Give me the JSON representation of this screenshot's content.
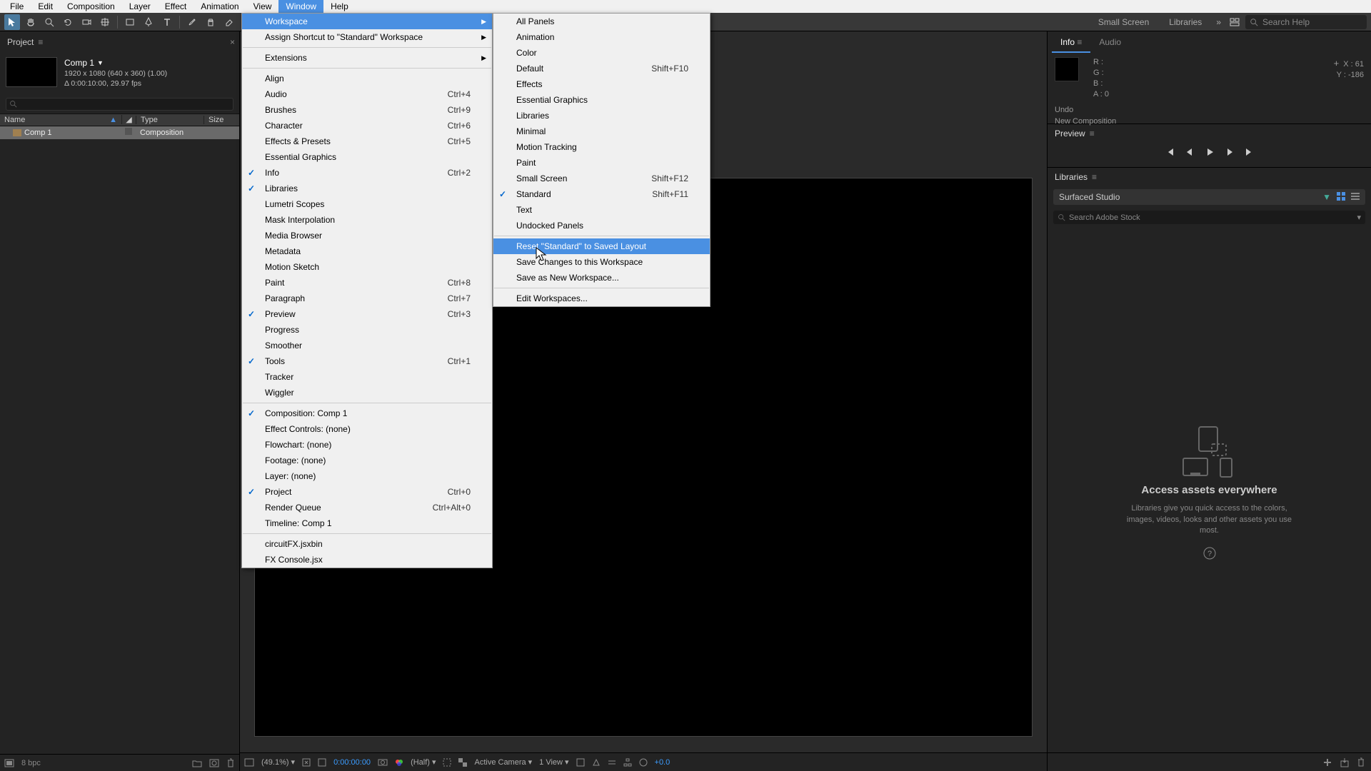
{
  "menubar": [
    "File",
    "Edit",
    "Composition",
    "Layer",
    "Effect",
    "Animation",
    "View",
    "Window",
    "Help"
  ],
  "menubar_active": "Window",
  "toolbar_tabs": {
    "small_screen": "Small Screen",
    "libraries": "Libraries"
  },
  "search_help": "Search Help",
  "project": {
    "tab": "Project",
    "comp_name": "Comp 1",
    "comp_res": "1920 x 1080   (640 x 360) (1.00)",
    "comp_dur": "Δ 0:00:10:00, 29.97 fps",
    "headers": {
      "name": "Name",
      "type": "Type",
      "size": "Size"
    },
    "rows": [
      {
        "name": "Comp 1",
        "type": "Composition",
        "size": ""
      }
    ],
    "footer_bpc": "8 bpc"
  },
  "info": {
    "tab": "Info",
    "audio": "Audio",
    "R": "R :",
    "G": "G :",
    "B": "B :",
    "A": "A : 0",
    "X": "X : 61",
    "Y": "Y : -186",
    "undo": "Undo",
    "newcomp": "New Composition"
  },
  "preview": {
    "tab": "Preview"
  },
  "libraries": {
    "tab": "Libraries",
    "dropdown": "Surfaced Studio",
    "search": "Search Adobe Stock",
    "ph_title": "Access assets everywhere",
    "ph_text": "Libraries give you quick access to the colors, images, videos, looks and other assets you use most."
  },
  "viewer_footer": {
    "zoom": "(49.1%)",
    "timecode": "0:00:00:00",
    "half": "(Half)",
    "active_camera": "Active Camera",
    "one_view": "1 View",
    "plus0": "+0.0"
  },
  "window_menu": [
    {
      "t": "item",
      "label": "Workspace",
      "arrow": true,
      "highlight": true
    },
    {
      "t": "item",
      "label": "Assign Shortcut to \"Standard\" Workspace",
      "arrow": true
    },
    {
      "t": "sep"
    },
    {
      "t": "item",
      "label": "Extensions",
      "arrow": true
    },
    {
      "t": "sep"
    },
    {
      "t": "item",
      "label": "Align"
    },
    {
      "t": "item",
      "label": "Audio",
      "shortcut": "Ctrl+4"
    },
    {
      "t": "item",
      "label": "Brushes",
      "shortcut": "Ctrl+9"
    },
    {
      "t": "item",
      "label": "Character",
      "shortcut": "Ctrl+6"
    },
    {
      "t": "item",
      "label": "Effects & Presets",
      "shortcut": "Ctrl+5"
    },
    {
      "t": "item",
      "label": "Essential Graphics"
    },
    {
      "t": "item",
      "label": "Info",
      "shortcut": "Ctrl+2",
      "check": true
    },
    {
      "t": "item",
      "label": "Libraries",
      "check": true
    },
    {
      "t": "item",
      "label": "Lumetri Scopes"
    },
    {
      "t": "item",
      "label": "Mask Interpolation"
    },
    {
      "t": "item",
      "label": "Media Browser"
    },
    {
      "t": "item",
      "label": "Metadata"
    },
    {
      "t": "item",
      "label": "Motion Sketch"
    },
    {
      "t": "item",
      "label": "Paint",
      "shortcut": "Ctrl+8"
    },
    {
      "t": "item",
      "label": "Paragraph",
      "shortcut": "Ctrl+7"
    },
    {
      "t": "item",
      "label": "Preview",
      "shortcut": "Ctrl+3",
      "check": true
    },
    {
      "t": "item",
      "label": "Progress"
    },
    {
      "t": "item",
      "label": "Smoother"
    },
    {
      "t": "item",
      "label": "Tools",
      "shortcut": "Ctrl+1",
      "check": true
    },
    {
      "t": "item",
      "label": "Tracker"
    },
    {
      "t": "item",
      "label": "Wiggler"
    },
    {
      "t": "sep"
    },
    {
      "t": "item",
      "label": "Composition: Comp 1",
      "check": true
    },
    {
      "t": "item",
      "label": "Effect Controls: (none)"
    },
    {
      "t": "item",
      "label": "Flowchart: (none)"
    },
    {
      "t": "item",
      "label": "Footage: (none)"
    },
    {
      "t": "item",
      "label": "Layer: (none)"
    },
    {
      "t": "item",
      "label": "Project",
      "shortcut": "Ctrl+0",
      "check": true
    },
    {
      "t": "item",
      "label": "Render Queue",
      "shortcut": "Ctrl+Alt+0"
    },
    {
      "t": "item",
      "label": "Timeline: Comp 1"
    },
    {
      "t": "sep"
    },
    {
      "t": "item",
      "label": "circuitFX.jsxbin"
    },
    {
      "t": "item",
      "label": "FX Console.jsx"
    }
  ],
  "workspace_submenu": [
    {
      "t": "item",
      "label": "All Panels"
    },
    {
      "t": "item",
      "label": "Animation"
    },
    {
      "t": "item",
      "label": "Color"
    },
    {
      "t": "item",
      "label": "Default",
      "shortcut": "Shift+F10"
    },
    {
      "t": "item",
      "label": "Effects"
    },
    {
      "t": "item",
      "label": "Essential Graphics"
    },
    {
      "t": "item",
      "label": "Libraries"
    },
    {
      "t": "item",
      "label": "Minimal"
    },
    {
      "t": "item",
      "label": "Motion Tracking"
    },
    {
      "t": "item",
      "label": "Paint"
    },
    {
      "t": "item",
      "label": "Small Screen",
      "shortcut": "Shift+F12"
    },
    {
      "t": "item",
      "label": "Standard",
      "shortcut": "Shift+F11",
      "check": true
    },
    {
      "t": "item",
      "label": "Text"
    },
    {
      "t": "item",
      "label": "Undocked Panels"
    },
    {
      "t": "sep"
    },
    {
      "t": "item",
      "label": "Reset \"Standard\" to Saved Layout",
      "highlight": true
    },
    {
      "t": "item",
      "label": "Save Changes to this Workspace"
    },
    {
      "t": "item",
      "label": "Save as New Workspace..."
    },
    {
      "t": "sep"
    },
    {
      "t": "item",
      "label": "Edit Workspaces..."
    }
  ]
}
